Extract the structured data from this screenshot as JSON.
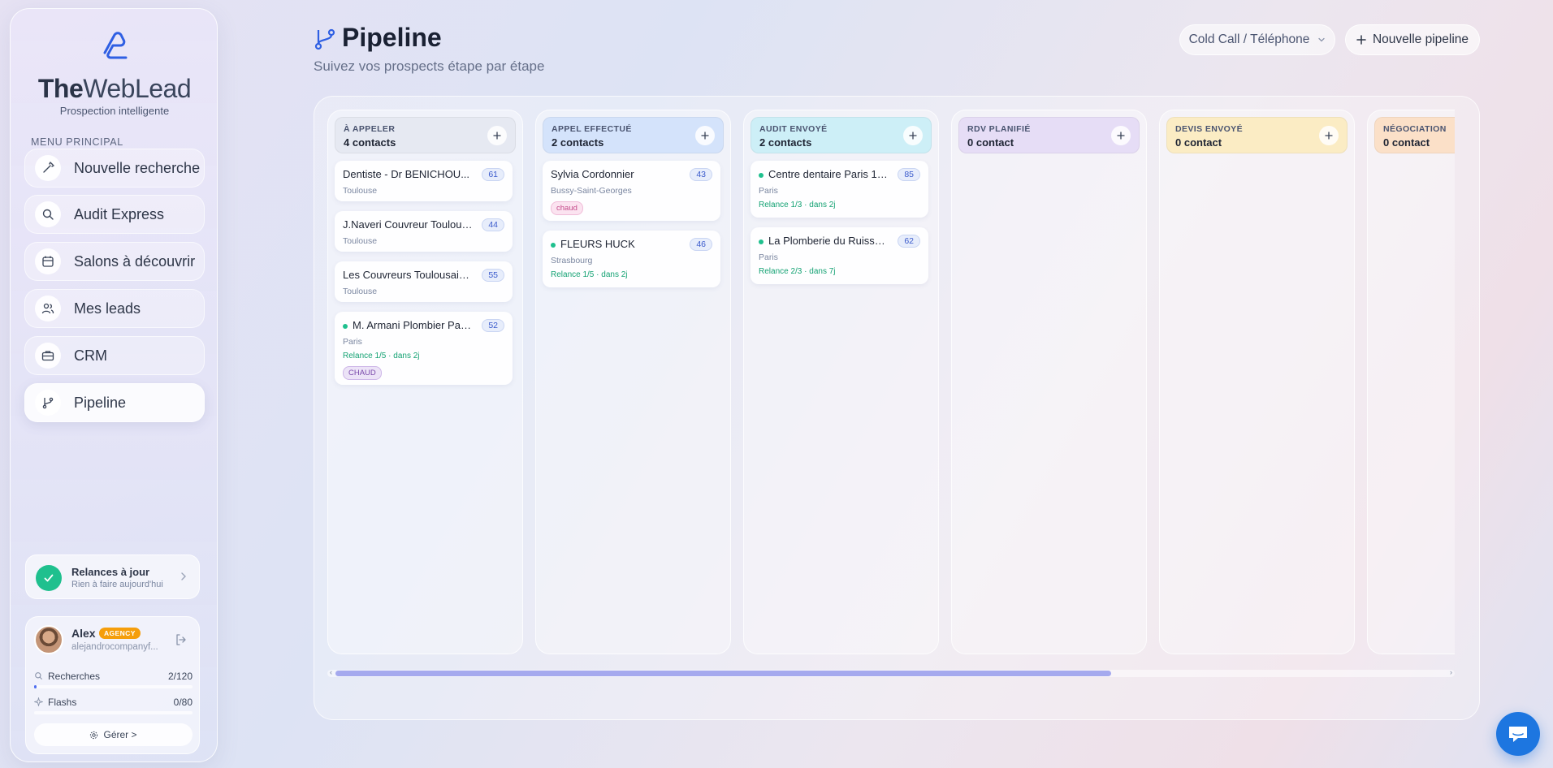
{
  "brand": {
    "name_part1": "The",
    "name_part2": "WebLead",
    "tagline": "Prospection intelligente"
  },
  "sidebar": {
    "menu_label": "MENU PRINCIPAL",
    "items": [
      {
        "label": "Nouvelle recherche",
        "icon": "magic-wand-icon"
      },
      {
        "label": "Audit Express",
        "icon": "search-icon"
      },
      {
        "label": "Salons à découvrir",
        "icon": "calendar-icon"
      },
      {
        "label": "Mes leads",
        "icon": "users-icon"
      },
      {
        "label": "CRM",
        "icon": "briefcase-icon"
      },
      {
        "label": "Pipeline",
        "icon": "git-branch-icon",
        "active": true
      }
    ],
    "relances": {
      "title": "Relances à jour",
      "subtitle": "Rien à faire aujourd'hui"
    },
    "user": {
      "name": "Alex",
      "badge": "AGENCY",
      "email": "alejandrocompanyf...",
      "recherches_label": "Recherches",
      "recherches_value": "2/120",
      "recherches_progress": 0.017,
      "flashs_label": "Flashs",
      "flashs_value": "0/80",
      "flashs_progress": 0,
      "manage_label": "Gérer >"
    }
  },
  "header": {
    "title": "Pipeline",
    "subtitle": "Suivez vos prospects étape par étape",
    "pipeline_select": "Cold Call / Téléphone",
    "new_button": "Nouvelle pipeline"
  },
  "columns": [
    {
      "title": "À APPELER",
      "count": "4 contacts",
      "color": "#e6e9f2",
      "cards": [
        {
          "name": "Dentiste - Dr BENICHOU...",
          "score": "61",
          "city": "Toulouse"
        },
        {
          "name": "J.Naveri Couvreur Toulous...",
          "score": "44",
          "city": "Toulouse"
        },
        {
          "name": "Les Couvreurs Toulousains...",
          "score": "55",
          "city": "Toulouse"
        },
        {
          "name": "M. Armani Plombier Paris...",
          "score": "52",
          "city": "Paris",
          "dot": true,
          "relance": "Relance 1/5 · dans 2j",
          "tag": "CHAUD",
          "tag_style": "upper"
        }
      ]
    },
    {
      "title": "APPEL EFFECTUÉ",
      "count": "2 contacts",
      "color": "#d4e3fb",
      "cards": [
        {
          "name": "Sylvia Cordonnier",
          "score": "43",
          "city": "Bussy-Saint-Georges",
          "tag": "chaud",
          "tag_style": "lower"
        },
        {
          "name": "FLEURS HUCK",
          "score": "46",
          "city": "Strasbourg",
          "dot": true,
          "relance": "Relance 1/5 · dans 2j"
        }
      ]
    },
    {
      "title": "AUDIT ENVOYÉ",
      "count": "2 contacts",
      "color": "#cdeff7",
      "cards": [
        {
          "name": "Centre dentaire Paris 10...",
          "score": "85",
          "city": "Paris",
          "dot": true,
          "relance": "Relance 1/3 · dans 2j"
        },
        {
          "name": "La Plomberie du Ruissea...",
          "score": "62",
          "city": "Paris",
          "dot": true,
          "relance": "Relance 2/3 · dans 7j"
        }
      ]
    },
    {
      "title": "RDV PLANIFIÉ",
      "count": "0 contact",
      "color": "#e6ddf6",
      "cards": []
    },
    {
      "title": "DEVIS ENVOYÉ",
      "count": "0 contact",
      "color": "#fbecc4",
      "cards": []
    },
    {
      "title": "NÉGOCIATION",
      "count": "0 contact",
      "color": "#fbe0c8",
      "cards": []
    }
  ]
}
